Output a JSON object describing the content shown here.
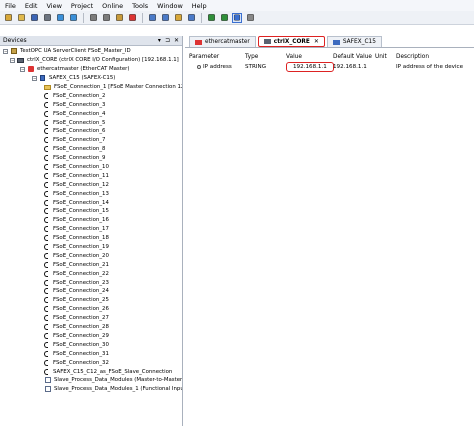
{
  "menu": [
    "File",
    "Edit",
    "View",
    "Project",
    "Online",
    "Tools",
    "Window",
    "Help"
  ],
  "toolbar": {
    "icons": [
      "new-project-icon",
      "open-project-icon",
      "save-icon",
      "print-icon",
      "undo-icon",
      "redo-icon",
      "cut-icon",
      "copy-icon",
      "paste-icon",
      "delete-icon",
      "find-icon",
      "replace-icon",
      "bookmark-icon",
      "goto-icon",
      "prev-icon",
      "next-icon",
      "debug-icon",
      "build-icon"
    ]
  },
  "devices": {
    "title": "Devices",
    "controls": [
      "▾",
      "⊐",
      "✕"
    ],
    "tree": [
      {
        "label": "TestOPC UA ServerClient FSoE_Master_ID",
        "level": 0,
        "icon": "root",
        "exp": "−"
      },
      {
        "label": "ctrlX_CORE (ctrlX CORE I/O Configuration) [192.168.1.1]",
        "level": 1,
        "icon": "ctrl",
        "exp": "−"
      },
      {
        "label": "ethercatmaster (EtherCAT Master)",
        "level": 2,
        "icon": "node",
        "exp": "−"
      },
      {
        "label": "SAFEX_C15 (SAFEX-C15)",
        "level": 3,
        "icon": "plc",
        "exp": "−"
      },
      {
        "label": "FSoE_Connection_1 [FSoE Master Connection 12",
        "level": 4,
        "icon": "folder",
        "exp": ""
      },
      {
        "label": "FSoE_Connection_2",
        "level": 4,
        "icon": "conn"
      },
      {
        "label": "FSoE_Connection_3",
        "level": 4,
        "icon": "conn"
      },
      {
        "label": "FSoE_Connection_4",
        "level": 4,
        "icon": "conn"
      },
      {
        "label": "FSoE_Connection_5",
        "level": 4,
        "icon": "conn"
      },
      {
        "label": "FSoE_Connection_6",
        "level": 4,
        "icon": "conn"
      },
      {
        "label": "FSoE_Connection_7",
        "level": 4,
        "icon": "conn"
      },
      {
        "label": "FSoE_Connection_8",
        "level": 4,
        "icon": "conn"
      },
      {
        "label": "FSoE_Connection_9",
        "level": 4,
        "icon": "conn"
      },
      {
        "label": "FSoE_Connection_10",
        "level": 4,
        "icon": "conn"
      },
      {
        "label": "FSoE_Connection_11",
        "level": 4,
        "icon": "conn"
      },
      {
        "label": "FSoE_Connection_12",
        "level": 4,
        "icon": "conn"
      },
      {
        "label": "FSoE_Connection_13",
        "level": 4,
        "icon": "conn"
      },
      {
        "label": "FSoE_Connection_14",
        "level": 4,
        "icon": "conn"
      },
      {
        "label": "FSoE_Connection_15",
        "level": 4,
        "icon": "conn"
      },
      {
        "label": "FSoE_Connection_16",
        "level": 4,
        "icon": "conn"
      },
      {
        "label": "FSoE_Connection_17",
        "level": 4,
        "icon": "conn"
      },
      {
        "label": "FSoE_Connection_18",
        "level": 4,
        "icon": "conn"
      },
      {
        "label": "FSoE_Connection_19",
        "level": 4,
        "icon": "conn"
      },
      {
        "label": "FSoE_Connection_20",
        "level": 4,
        "icon": "conn"
      },
      {
        "label": "FSoE_Connection_21",
        "level": 4,
        "icon": "conn"
      },
      {
        "label": "FSoE_Connection_22",
        "level": 4,
        "icon": "conn"
      },
      {
        "label": "FSoE_Connection_23",
        "level": 4,
        "icon": "conn"
      },
      {
        "label": "FSoE_Connection_24",
        "level": 4,
        "icon": "conn"
      },
      {
        "label": "FSoE_Connection_25",
        "level": 4,
        "icon": "conn"
      },
      {
        "label": "FSoE_Connection_26",
        "level": 4,
        "icon": "conn"
      },
      {
        "label": "FSoE_Connection_27",
        "level": 4,
        "icon": "conn"
      },
      {
        "label": "FSoE_Connection_28",
        "level": 4,
        "icon": "conn"
      },
      {
        "label": "FSoE_Connection_29",
        "level": 4,
        "icon": "conn"
      },
      {
        "label": "FSoE_Connection_30",
        "level": 4,
        "icon": "conn"
      },
      {
        "label": "FSoE_Connection_31",
        "level": 4,
        "icon": "conn"
      },
      {
        "label": "FSoE_Connection_32",
        "level": 4,
        "icon": "conn"
      },
      {
        "label": "SAFEX_C15_C12_as_FSoE_Slave_Connection",
        "level": 4,
        "icon": "conn"
      },
      {
        "label": "Slave_Process_Data_Modules (Master-to-Master C",
        "level": 4,
        "icon": "doc"
      },
      {
        "label": "Slave_Process_Data_Modules_1 (Functional Input",
        "level": 4,
        "icon": "doc"
      }
    ]
  },
  "tabs": [
    {
      "label": "ethercatmaster",
      "active": false,
      "close": ""
    },
    {
      "label": "ctrlX_CORE",
      "active": true,
      "close": "✕"
    },
    {
      "label": "SAFEX_C15",
      "active": false,
      "close": ""
    }
  ],
  "params": {
    "headers": [
      "Parameter",
      "Type",
      "Value",
      "Default Value",
      "Unit",
      "Description"
    ],
    "rows": [
      {
        "parameter": "IP address",
        "type": "STRING",
        "value": "192.168.1.1",
        "default": "192.168.1.1",
        "unit": "",
        "description": "IP address of the device"
      }
    ]
  }
}
